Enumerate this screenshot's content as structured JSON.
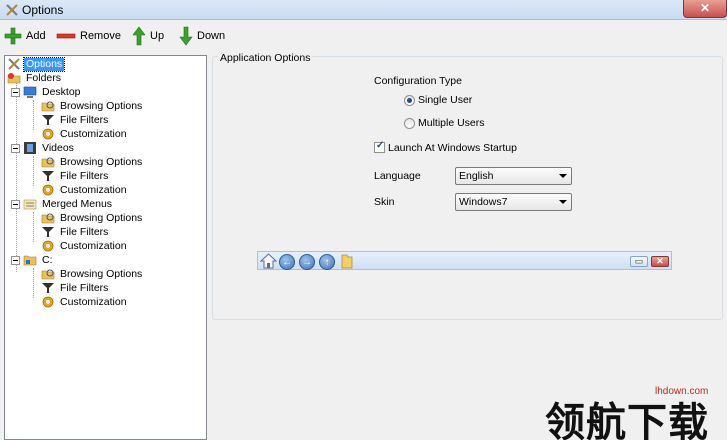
{
  "window": {
    "title": "Options",
    "close_glyph": "✕",
    "app_icon": "options-tools-icon"
  },
  "toolbar": {
    "add_label": "Add",
    "remove_label": "Remove",
    "up_label": "Up",
    "down_label": "Down",
    "colors": {
      "add": "#3aa12e",
      "remove": "#d9352a",
      "up": "#3aa12e",
      "down": "#3aa12e"
    }
  },
  "tree": {
    "root": "Options",
    "folders": "Folders",
    "groups": [
      {
        "label": "Desktop",
        "icon": "desktop-icon",
        "children": [
          "Browsing Options",
          "File Filters",
          "Customization"
        ]
      },
      {
        "label": "Videos",
        "icon": "videos-icon",
        "children": [
          "Browsing Options",
          "File Filters",
          "Customization"
        ]
      },
      {
        "label": "Merged Menus",
        "icon": "merged-menus-icon",
        "children": [
          "Browsing Options",
          "File Filters",
          "Customization"
        ]
      },
      {
        "label": "C:",
        "icon": "drive-icon",
        "children": [
          "Browsing Options",
          "File Filters",
          "Customization"
        ]
      }
    ],
    "child_icons": [
      "browsing-options-icon",
      "file-filters-icon",
      "customization-icon"
    ],
    "selected": "Options"
  },
  "panel": {
    "group_title": "Application Options",
    "config_type_label": "Configuration Type",
    "single_user": "Single User",
    "multiple_users": "Multiple Users",
    "config_selected": "Single User",
    "startup_label": "Launch At Windows Startup",
    "startup_checked": true,
    "language_label": "Language",
    "language_value": "English",
    "skin_label": "Skin",
    "skin_value": "Windows7"
  },
  "preview": {
    "nav_glyphs": [
      "←",
      "→",
      "↑"
    ],
    "restore_glyph": "▭",
    "close_glyph": "✕"
  },
  "watermark": {
    "site": "lhdown.com",
    "text": "领航下载"
  },
  "colors": {
    "selection": "#3399ff",
    "accent_blue": "#3f74b8",
    "close_red": "#c75050"
  }
}
